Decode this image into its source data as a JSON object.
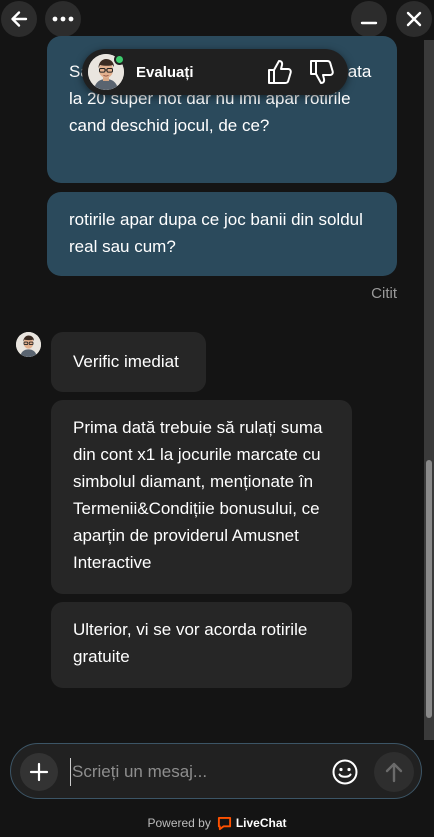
{
  "header": {
    "back_icon": "arrow-left-icon",
    "more_icon": "more-dots-icon",
    "minimize_icon": "minimize-icon",
    "close_icon": "close-icon"
  },
  "rating": {
    "label": "Evaluați",
    "thumbs_up_icon": "thumbs-up-icon",
    "thumbs_down_icon": "thumbs-down-icon"
  },
  "messages": {
    "user_1": "Salut, am primit rotiri gratuite de la roata la 20 super hot dar nu imi apar rotirile cand deschid jocul, de ce?",
    "user_2": "rotirile apar dupa ce joc banii din soldul real sau cum?",
    "read_status": "Citit",
    "agent_1": "Verific imediat",
    "agent_2": "Prima dată trebuie să rulați suma din cont x1 la jocurile marcate cu simbolul diamant, menționate în Termenii&Condițiie bonusului, ce aparțin de providerul Amusnet Interactive",
    "agent_3": "Ulterior, vi se vor acorda rotirile gratuite"
  },
  "composer": {
    "placeholder": "Scrieți un mesaj...",
    "value": "",
    "plus_icon": "plus-icon",
    "emoji_icon": "emoji-icon",
    "send_icon": "send-arrow-icon"
  },
  "footer": {
    "powered_by": "Powered by",
    "brand": "LiveChat"
  },
  "colors": {
    "background": "#141414",
    "user_bubble": "#2b4a5c",
    "agent_bubble": "#262626",
    "online": "#3dcc6d",
    "brand_orange": "#ff5100"
  }
}
